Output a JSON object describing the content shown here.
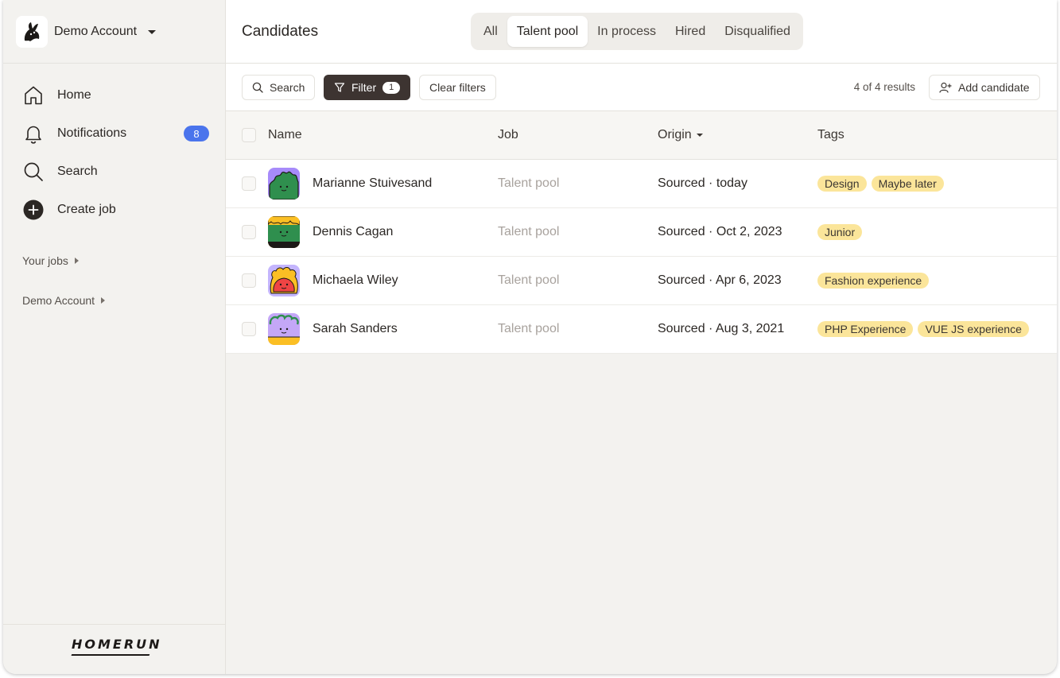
{
  "sidebar": {
    "account_name": "Demo Account",
    "nav": [
      {
        "label": "Home",
        "icon": "home-icon"
      },
      {
        "label": "Notifications",
        "icon": "bell-icon",
        "badge": "8"
      },
      {
        "label": "Search",
        "icon": "search-icon"
      },
      {
        "label": "Create job",
        "icon": "plus-circle-icon"
      }
    ],
    "your_jobs": "Your jobs",
    "account_section": "Demo Account",
    "brand": "HOMERUN"
  },
  "header": {
    "title": "Candidates",
    "tabs": [
      "All",
      "Talent pool",
      "In process",
      "Hired",
      "Disqualified"
    ],
    "active_tab": "Talent pool"
  },
  "toolbar": {
    "search_label": "Search",
    "filter_label": "Filter",
    "filter_count": "1",
    "clear_label": "Clear filters",
    "results": "4 of 4 results",
    "add_label": "Add candidate"
  },
  "table": {
    "columns": [
      "Name",
      "Job",
      "Origin",
      "Tags"
    ],
    "rows": [
      {
        "name": "Marianne Stuivesand",
        "job": "Talent pool",
        "origin": "Sourced · today",
        "tags": [
          "Design",
          "Maybe later"
        ],
        "avatar_bg": "#a78bfa",
        "avatar_fg": "#2f8f4e"
      },
      {
        "name": "Dennis Cagan",
        "job": "Talent pool",
        "origin": "Sourced · Oct 2, 2023",
        "tags": [
          "Junior"
        ],
        "avatar_bg": "#fbbf24",
        "avatar_fg": "#2f8f4e"
      },
      {
        "name": "Michaela Wiley",
        "job": "Talent pool",
        "origin": "Sourced · Apr 6, 2023",
        "tags": [
          "Fashion experience"
        ],
        "avatar_bg": "#c4b5fd",
        "avatar_fg": "#ef4444"
      },
      {
        "name": "Sarah Sanders",
        "job": "Talent pool",
        "origin": "Sourced · Aug 3, 2021",
        "tags": [
          "PHP Experience",
          "VUE JS experience"
        ],
        "avatar_bg": "#fbbf24",
        "avatar_fg": "#c4a7f7"
      }
    ]
  },
  "colors": {
    "accent_badge": "#4a74ec",
    "tag_bg": "#fbe59a",
    "filter_bg": "#3d3431"
  }
}
